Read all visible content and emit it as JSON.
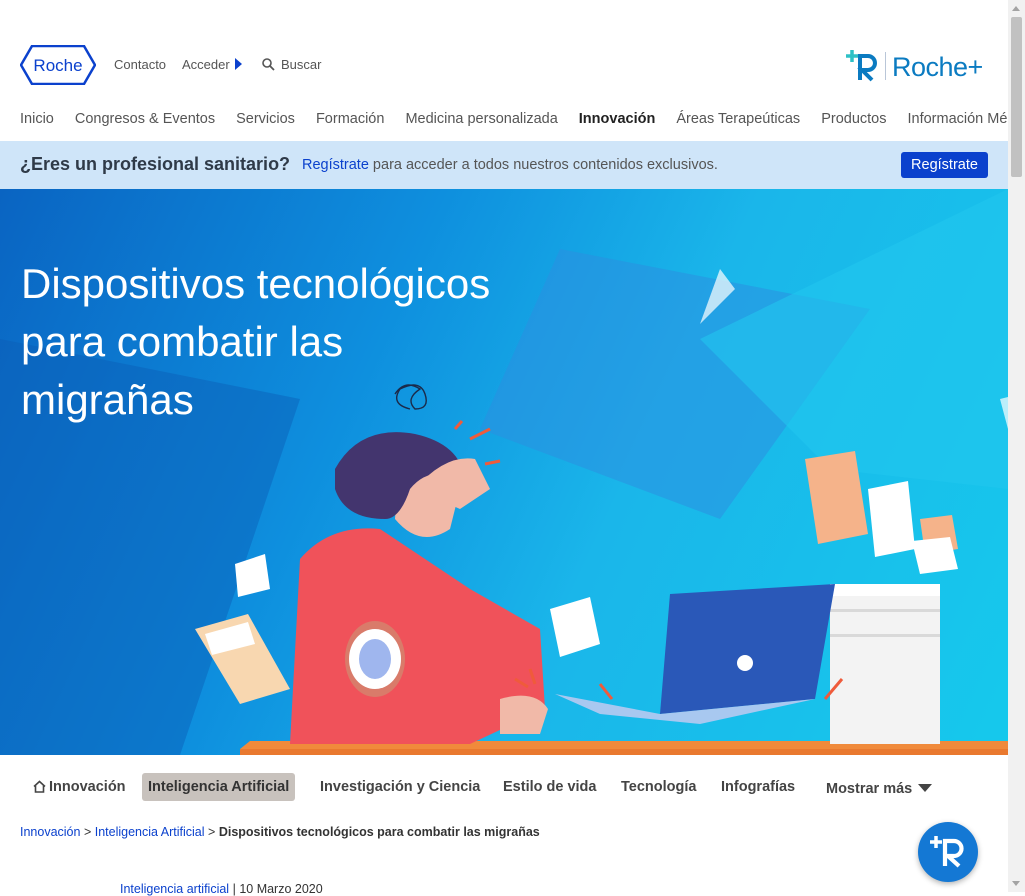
{
  "header": {
    "logo_text": "Roche",
    "contact_label": "Contacto",
    "login_label": "Acceder",
    "search_placeholder": "Buscar",
    "brand_text": "Roche+"
  },
  "nav": {
    "items": [
      "Inicio",
      "Congresos & Eventos",
      "Servicios",
      "Formación",
      "Medicina personalizada",
      "Innovación",
      "Áreas Terapeúticas",
      "Productos",
      "Información Médica"
    ],
    "active": "Innovación"
  },
  "promo": {
    "question": "¿Eres un profesional sanitario?",
    "link_label": "Regístrate",
    "text": " para acceder a todos nuestros contenidos exclusivos.",
    "button_label": "Regístrate"
  },
  "hero": {
    "title": "Dispositivos tecnológicos para combatir las migrañas"
  },
  "category_tabs": {
    "items": [
      "Innovación",
      "Inteligencia Artificial",
      "Investigación y Ciencia",
      "Estilo de vida",
      "Tecnología",
      "Infografías",
      "Mostrar más"
    ],
    "selected": "Inteligencia Artificial"
  },
  "breadcrumb": {
    "items": [
      "Innovación",
      "Inteligencia Artificial"
    ],
    "separator": ">",
    "current": "Dispositivos tecnológicos para combatir las migrañas"
  },
  "article_meta": {
    "category": "Inteligencia artificial",
    "date": "10 Marzo 2020"
  },
  "colors": {
    "roche_blue": "#0b41cd",
    "promo_bg": "#cfe5f9",
    "selected_tab_bg": "#c8c2bd",
    "fab_blue": "#1478d4"
  }
}
